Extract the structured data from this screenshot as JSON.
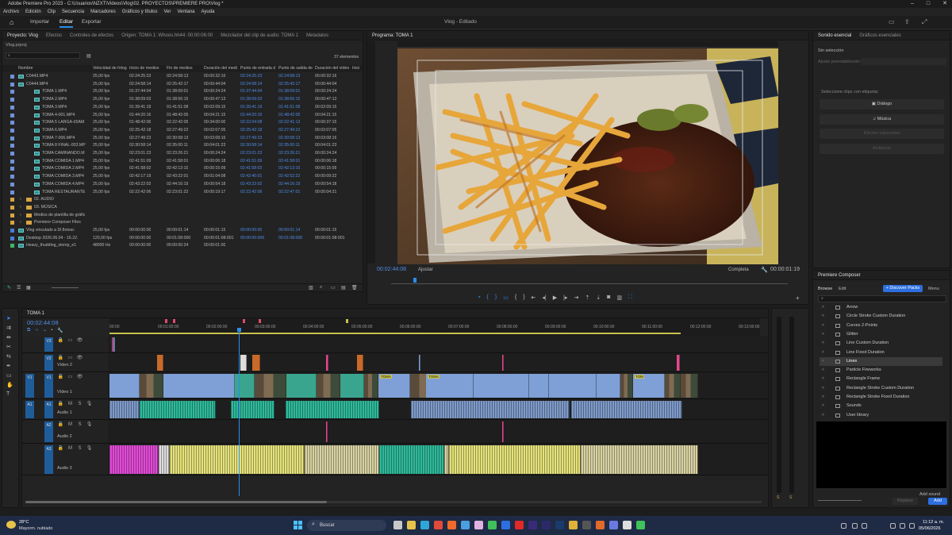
{
  "window": {
    "title": "Adobe Premiere Pro 2023 - C:\\Usuarios\\NZXT\\Videos\\Vlog\\02. PROYECTOS\\PREMIERE PRO\\Vlog *"
  },
  "menu": [
    "Archivo",
    "Edición",
    "Clip",
    "Secuencia",
    "Marcadores",
    "Gráficos y títulos",
    "Ver",
    "Ventana",
    "Ayuda"
  ],
  "workspaces": {
    "import": "Importar",
    "edit": "Editar",
    "export": "Exportar",
    "center": "Vlog - Editado"
  },
  "project": {
    "tabs": [
      "Proyecto: Vlog",
      "Efectos",
      "Controles de efectos",
      "Origen: TOMA 1: Whoos.hh44: 00:00:06:00",
      "Mezclador del clip de audio: TOMA 1",
      "Metadatos"
    ],
    "folder": "Vlog.prproj",
    "count": "37 elementos",
    "columns": [
      "Nombre",
      "Velocidad de fotog",
      "Inicio de medios",
      "Fin de medios",
      "Duración del medi",
      "Punto de entrada d",
      "Punto de salida de",
      "Duración del vídeo",
      "Inici"
    ],
    "rows": [
      {
        "name": "C0443.MP4",
        "fps": "25,00 fps",
        "start": "02:24:25:23",
        "end": "02:24:58:13",
        "dur": "00:00:32:16",
        "in": "02:24:25:23",
        "out": "02:24:58:13",
        "vdur": "00:00:32:16",
        "indent": 0
      },
      {
        "name": "C0444.MP4",
        "fps": "25,00 fps",
        "start": "02:24:58:14",
        "end": "02:25:42:17",
        "dur": "00:00:44:04",
        "in": "02:24:58:14",
        "out": "02:25:42:17",
        "vdur": "00:00:44:04",
        "indent": 0
      },
      {
        "name": "TOMA 1.MP4",
        "fps": "25,00 fps",
        "start": "01:37:44:04",
        "end": "01:38:09:01",
        "dur": "00:00:24:24",
        "in": "01:37:44:04",
        "out": "01:38:09:01",
        "vdur": "00:00:24:24",
        "indent": 1
      },
      {
        "name": "TOMA 2.MP4",
        "fps": "25,00 fps",
        "start": "01:38:09:03",
        "end": "01:38:56:15",
        "dur": "00:00:47:13",
        "in": "01:38:09:03",
        "out": "01:38:56:15",
        "vdur": "00:00:47:13",
        "indent": 1
      },
      {
        "name": "TOMA 3.MP4",
        "fps": "25,00 fps",
        "start": "01:39:41:19",
        "end": "01:41:51:08",
        "dur": "00:02:09:15",
        "in": "01:39:41:19",
        "out": "01:41:51:08",
        "vdur": "00:02:09:15",
        "indent": 1
      },
      {
        "name": "TOMA 4-001.MP4",
        "fps": "25,00 fps",
        "start": "01:44:20:16",
        "end": "01:48:42:05",
        "dur": "00:04:21:15",
        "in": "01:44:20:16",
        "out": "01:48:42:05",
        "vdur": "00:04:21:15",
        "indent": 1
      },
      {
        "name": "TOMA 5 LARGA-00AM",
        "fps": "25,00 fps",
        "start": "01:48:42:06",
        "end": "02:22:42:05",
        "dur": "00:34:00:00",
        "in": "02:22:04:08",
        "out": "02:22:41:12",
        "vdur": "00:00:37:15",
        "indent": 1
      },
      {
        "name": "TOMA 6.MP4",
        "fps": "25,00 fps",
        "start": "02:25:42:18",
        "end": "02:27:49:22",
        "dur": "00:02:07:05",
        "in": "02:25:42:18",
        "out": "02:27:49:22",
        "vdur": "00:02:07:05",
        "indent": 1
      },
      {
        "name": "TOMA 7-006.MP4",
        "fps": "25,00 fps",
        "start": "02:27:49:23",
        "end": "02:30:58:13",
        "dur": "00:03:08:16",
        "in": "02:27:49:23",
        "out": "02:30:58:13",
        "vdur": "00:03:08:16",
        "indent": 1
      },
      {
        "name": "TOMA 8 FINAL-003.MP",
        "fps": "25,00 fps",
        "start": "02:30:58:14",
        "end": "02:35:00:11",
        "dur": "00:04:01:23",
        "in": "02:30:58:14",
        "out": "02:35:00:11",
        "vdur": "00:04:01:23",
        "indent": 1
      },
      {
        "name": "TOMA CAMINANDO.M",
        "fps": "25,00 fps",
        "start": "02:23:01:23",
        "end": "02:23:26:21",
        "dur": "00:00:24:24",
        "in": "02:23:01:23",
        "out": "02:23:26:21",
        "vdur": "00:00:24:24",
        "indent": 1
      },
      {
        "name": "TOMA COMIDA 1.MP4",
        "fps": "25,00 fps",
        "start": "02:41:51:09",
        "end": "02:41:58:01",
        "dur": "00:00:06:18",
        "in": "02:41:51:09",
        "out": "02:41:58:01",
        "vdur": "00:00:06:18",
        "indent": 1
      },
      {
        "name": "TOMA COMIDA 2.MP4",
        "fps": "25,00 fps",
        "start": "02:41:58:02",
        "end": "02:42:13:10",
        "dur": "00:00:15:09",
        "in": "02:41:58:02",
        "out": "02:42:13:10",
        "vdur": "00:00:15:09",
        "indent": 1
      },
      {
        "name": "TOMA COMIDA 3.MP4",
        "fps": "25,00 fps",
        "start": "02:42:17:19",
        "end": "02:43:22:01",
        "dur": "00:01:04:08",
        "in": "02:42:40:01",
        "out": "02:42:52:22",
        "vdur": "00:00:09:22",
        "indent": 1
      },
      {
        "name": "TOMA COMIDA 4.MP4",
        "fps": "25,00 fps",
        "start": "02:43:22:02",
        "end": "02:44:16:19",
        "dur": "00:00:54:18",
        "in": "02:43:22:02",
        "out": "02:44:16:19",
        "vdur": "00:00:54:18",
        "indent": 1
      },
      {
        "name": "TOMA RESTAURANTE",
        "fps": "25,00 fps",
        "start": "02:22:42:06",
        "end": "02:23:01:22",
        "dur": "00:00:19:17",
        "in": "02:22:42:06",
        "out": "02:22:47:01",
        "vdur": "00:00:04:21",
        "indent": 1
      },
      {
        "name": "02. AUDIO",
        "fps": "",
        "start": "",
        "end": "",
        "dur": "",
        "in": "",
        "out": "",
        "vdur": "",
        "indent": 0,
        "folder": true
      },
      {
        "name": "03. MÚSICA",
        "fps": "",
        "start": "",
        "end": "",
        "dur": "",
        "in": "",
        "out": "",
        "vdur": "",
        "indent": 0,
        "folder": true
      },
      {
        "name": "Medios de plantilla de gráfic",
        "fps": "",
        "start": "",
        "end": "",
        "dur": "",
        "in": "",
        "out": "",
        "vdur": "",
        "indent": 0,
        "folder": true
      },
      {
        "name": "Premiere Composer Files",
        "fps": "",
        "start": "",
        "end": "",
        "dur": "",
        "in": "",
        "out": "",
        "vdur": "",
        "indent": 0,
        "folder": true
      },
      {
        "name": "Vlog vinculado a Dl.flotosc",
        "fps": "25,00 fps",
        "start": "00:00:00:00",
        "end": "00:00:01:14",
        "dur": "00:00:01:15",
        "in": "00:00:00:00",
        "out": "00:00:01:14",
        "vdur": "00:00:01:15",
        "indent": 0
      },
      {
        "name": "Desktop 2026.06.04 - 16.22.",
        "fps": "120,00 fps",
        "start": "00:00:00:00",
        "end": "00:01:08:000",
        "dur": "00:00:01:08:001",
        "in": "00:00:00:000",
        "out": "00:01:08:000",
        "vdur": "00:00:01:08:001",
        "indent": 0
      },
      {
        "name": "Heavy_thudding_stomp_e1",
        "fps": "48000 Hz",
        "start": "00:00:00:00",
        "end": "00:00:00:24",
        "dur": "00:00:01:00",
        "in": "",
        "out": "",
        "vdur": "",
        "indent": 0
      }
    ]
  },
  "program": {
    "tab": "Programa: TOMA 1",
    "timecode": "00:02:44:08",
    "fit": "Ajustar",
    "quality": "Completa",
    "duration": "00:00:01:19"
  },
  "essential_sound": {
    "tabs": [
      "Sonido esencial",
      "Gráficos esenciales"
    ],
    "no_selection": "Sin selección",
    "preset_label": "Ajuste preestablecido:",
    "prompt": "Seleccione clips con etiqueta:",
    "buttons": [
      "Diálogo",
      "Música",
      "Efectos especiales",
      "Ambiente"
    ]
  },
  "timeline": {
    "tab": "TOMA 1",
    "timecode": "00:02:44:08",
    "ruler": [
      "00:00",
      "00:01:00:00",
      "00:02:00:00",
      "00:03:00:00",
      "00:04:00:00",
      "00:05:00:00",
      "00:06:00:00",
      "00:07:00:00",
      "00:08:00:00",
      "00:09:00:00",
      "00:10:00:00",
      "00:11:00:00",
      "00:12:00:00",
      "00:13:00:00"
    ],
    "tracks": [
      {
        "id": "V3",
        "name": "",
        "label": "V3"
      },
      {
        "id": "V2",
        "name": "Vídeo 2",
        "label": "V2"
      },
      {
        "id": "V1",
        "name": "Vídeo 1",
        "label": "V1"
      },
      {
        "id": "A1",
        "name": "Audio 1",
        "label": "A1"
      },
      {
        "id": "A2",
        "name": "Audio 2",
        "label": "A2"
      },
      {
        "id": "A3",
        "name": "Audio 3",
        "label": "A3"
      }
    ],
    "clip_label": "TOMA",
    "clip_label2": "TOM"
  },
  "composer": {
    "tab": "Premiere Composer",
    "browse": "Browse",
    "edit": "Edit",
    "discover": "+ Discover Packs",
    "menu": "Menu",
    "items": [
      "Arrow",
      "Circle Stroke Custom Duration",
      "Curves 2-Points",
      "Glitter",
      "Line Custom Duration",
      "Line Fixed Duration",
      "Lines",
      "Particle Fireworks",
      "Rectangle Frame",
      "Rectangle Stroke Custom Duration",
      "Rectangle Stroke Fixed Duration",
      "Sounds",
      "User library"
    ],
    "add_sound": "Add sound",
    "replace": "Replace",
    "add": "Add"
  },
  "meters": {
    "s1": "S",
    "s2": "S"
  },
  "taskbar": {
    "temp": "28°C",
    "weather": "Mayorm. nublado",
    "search": "Buscar",
    "time": "11:12 a. m.",
    "date": "05/06/2026"
  },
  "colors": {
    "accent": "#2d8ceb",
    "video": "#7ea0d6",
    "audio_teal": "#2fb99a",
    "audio_yellow": "#e4e27a",
    "audio_pink": "#e04bd6",
    "marker": "#e04a6c"
  }
}
